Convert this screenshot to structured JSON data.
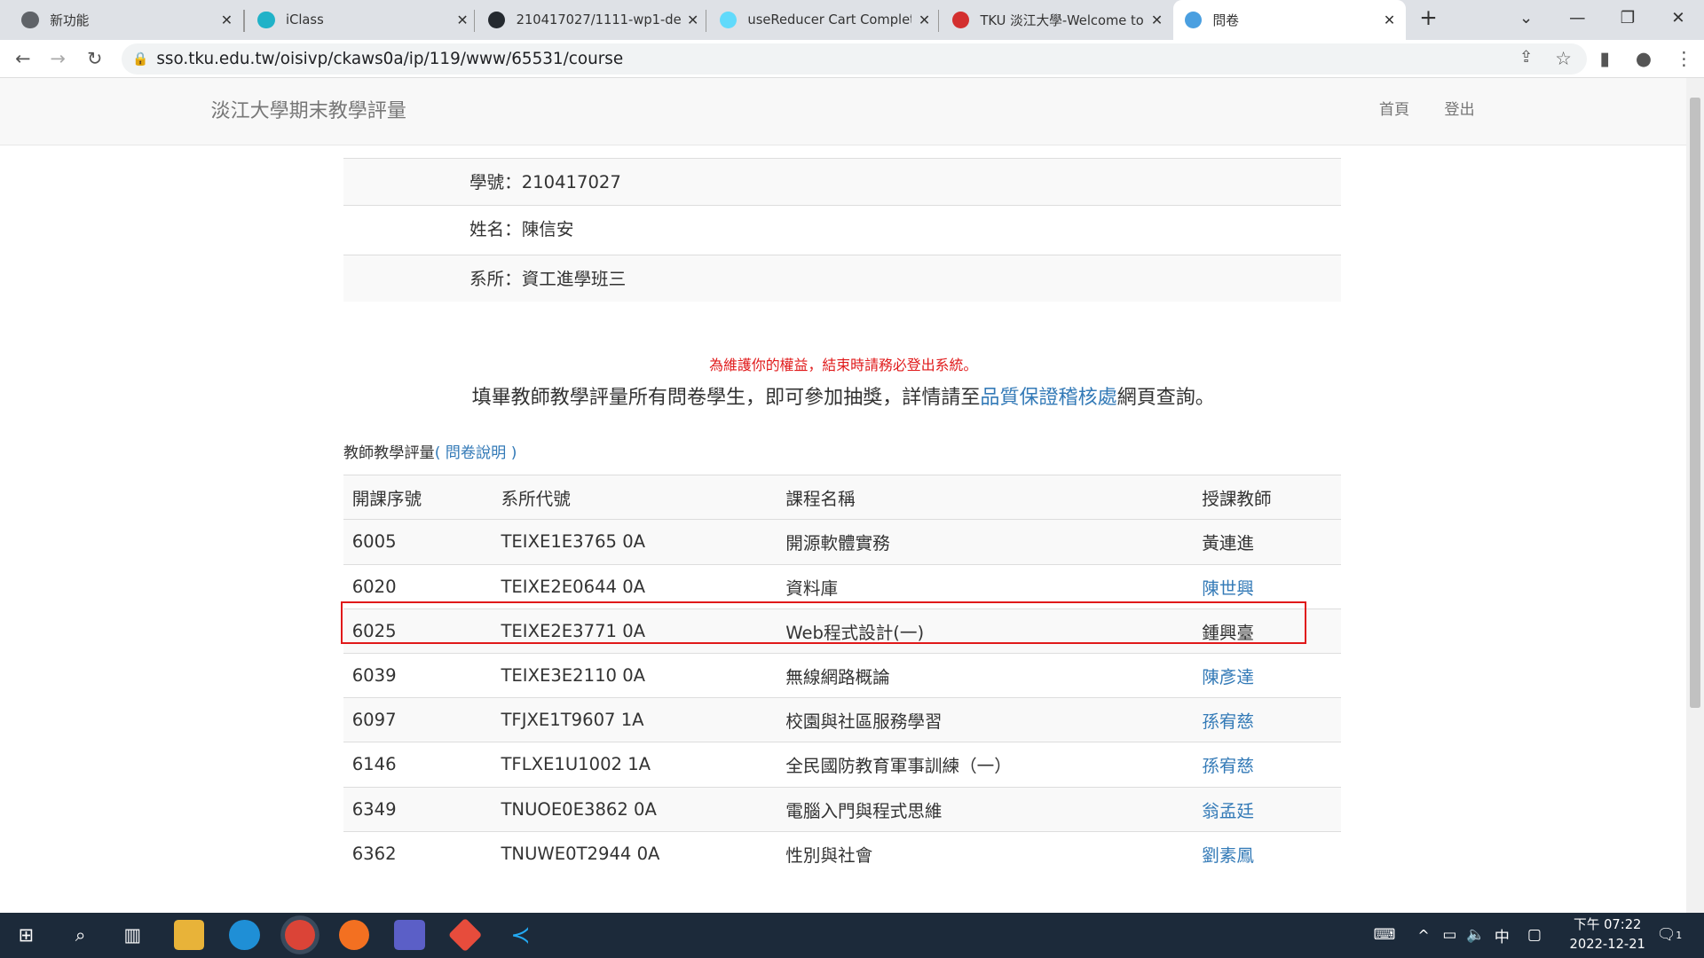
{
  "browser": {
    "tabs": [
      {
        "title": "新功能",
        "color": "#5f6368"
      },
      {
        "title": "iClass",
        "color": "#20b2c8"
      },
      {
        "title": "210417027/1111-wp1-de",
        "color": "#24292f"
      },
      {
        "title": "useReducer Cart Complet",
        "color": "#61dafb"
      },
      {
        "title": "TKU 淡江大學-Welcome to",
        "color": "#d32f2f"
      },
      {
        "title": "問卷",
        "color": "#4a9fe0"
      }
    ],
    "url": "sso.tku.edu.tw/oisivp/ckaws0a/ip/119/www/65531/course"
  },
  "header": {
    "brand": "淡江大學期末教學評量",
    "home": "首頁",
    "logout": "登出"
  },
  "info": {
    "id": "學號：210417027",
    "name": "姓名：陳信安",
    "dept": "系所：資工進學班三"
  },
  "notice": {
    "warning": "為維護你的權益，結束時請務必登出系統。",
    "text_before": "填畢教師教學評量所有問卷學生，即可參加抽獎，詳情請至",
    "link": "品質保證稽核處",
    "text_after": "網頁查詢。"
  },
  "caption": {
    "label": "教師教學評量",
    "link": "( 問卷說明 )"
  },
  "table": {
    "headers": [
      "開課序號",
      "系所代號",
      "課程名稱",
      "授課教師"
    ],
    "rows": [
      {
        "no": "6005",
        "code": "TEIXE1E3765 0A",
        "course": "開源軟體實務",
        "teacher": "黃連進",
        "linked": false
      },
      {
        "no": "6020",
        "code": "TEIXE2E0644 0A",
        "course": "資料庫",
        "teacher": "陳世興",
        "linked": true
      },
      {
        "no": "6025",
        "code": "TEIXE2E3771 0A",
        "course": "Web程式設計(一)",
        "teacher": "鍾興臺",
        "linked": false
      },
      {
        "no": "6039",
        "code": "TEIXE3E2110 0A",
        "course": "無線網路概論",
        "teacher": "陳彥達",
        "linked": true
      },
      {
        "no": "6097",
        "code": "TFJXE1T9607 1A",
        "course": "校園與社區服務學習",
        "teacher": "孫宥慈",
        "linked": true
      },
      {
        "no": "6146",
        "code": "TFLXE1U1002 1A",
        "course": "全民國防教育軍事訓練（一）",
        "teacher": "孫宥慈",
        "linked": true
      },
      {
        "no": "6349",
        "code": "TNUOE0E3862 0A",
        "course": "電腦入門與程式思維",
        "teacher": "翁孟廷",
        "linked": true
      },
      {
        "no": "6362",
        "code": "TNUWE0T2944 0A",
        "course": "性別與社會",
        "teacher": "劉素鳳",
        "linked": true
      }
    ]
  },
  "taskbar": {
    "ime": "中",
    "time": "下午 07:22",
    "date": "2022-12-21",
    "notifications": "1"
  }
}
